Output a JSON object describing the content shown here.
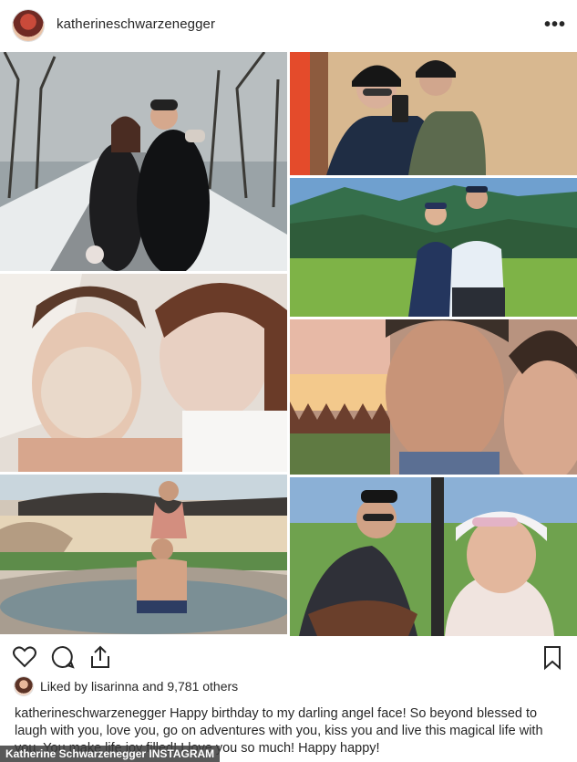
{
  "post": {
    "username": "katherineschwarzenegger",
    "more_label": "•••",
    "liked_by_prefix": "Liked by",
    "liked_by_user": "lisarinna",
    "liked_by_suffix": "and 9,781 others",
    "caption_user": "katherineschwarzenegger",
    "caption_text": "Happy birthday to my darling angel face! So beyond blessed to laugh with you, love you, go on adventures with you, kiss you and live this magical life with you. You make life joy filled! I love you so much! Happy happy!",
    "photo_credit": "Katherine Schwarzenegger INSTAGRAM"
  },
  "icons": {
    "like": "heart-icon",
    "comment": "comment-icon",
    "share": "share-icon",
    "save": "bookmark-icon",
    "more": "more-icon"
  }
}
